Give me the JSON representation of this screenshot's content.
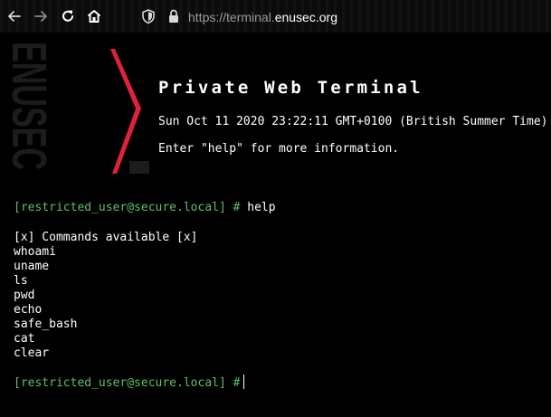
{
  "browser": {
    "url_prefix": "https://terminal.",
    "url_host": "enusec",
    "url_suffix": ".org",
    "icons": [
      "back-arrow-icon",
      "forward-arrow-icon",
      "reload-icon",
      "home-icon",
      "shield-icon",
      "lock-icon"
    ]
  },
  "logo": {
    "text": "ENUSEC",
    "accent_color": "#e0213b"
  },
  "header": {
    "title": "Private Web Terminal",
    "date": "Sun Oct 11 2020 23:22:11 GMT+0100 (British Summer Time)",
    "info": "Enter \"help\" for more information."
  },
  "terminal": {
    "prompt": "[restricted_user@secure.local] #",
    "first_command": "help",
    "output_header": "[x] Commands available [x]",
    "commands": [
      "whoami",
      "uname",
      "ls",
      "pwd",
      "echo",
      "safe_bash",
      "cat",
      "clear"
    ],
    "prompt_color": "#5fbf6a"
  }
}
